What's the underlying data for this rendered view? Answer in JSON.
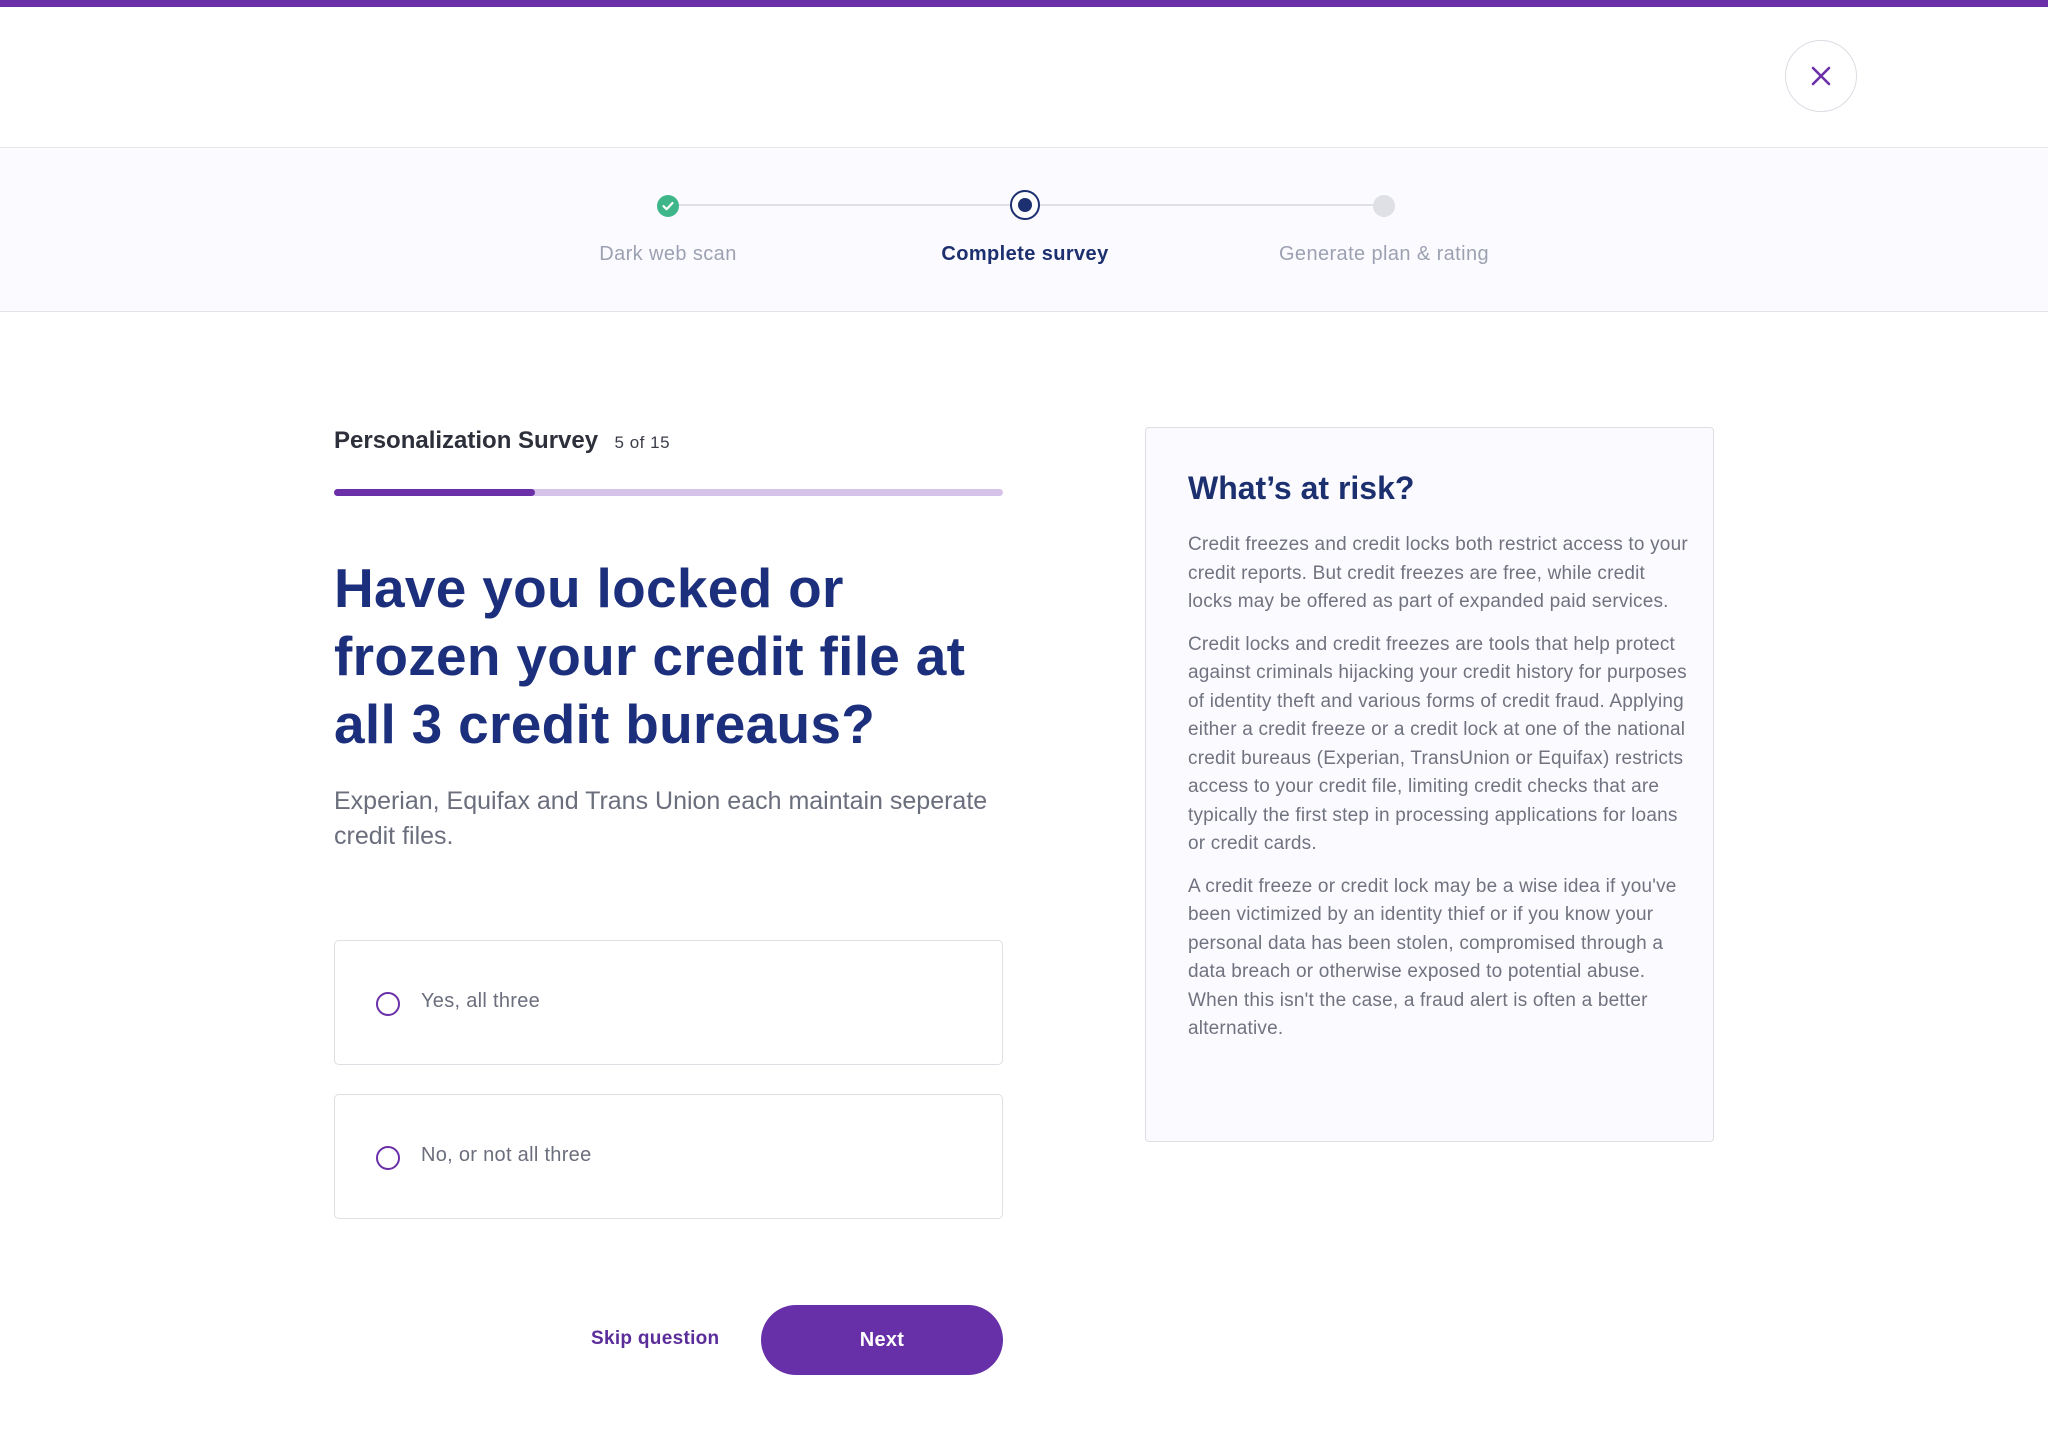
{
  "header": {
    "close_icon": "close-icon",
    "accent_color": "#6b2fa8"
  },
  "stepper": {
    "steps": [
      {
        "label": "Dark web scan",
        "state": "done",
        "icon": "check-circle-icon"
      },
      {
        "label": "Complete survey",
        "state": "active",
        "icon": "radio-dot-icon"
      },
      {
        "label": "Generate plan & rating",
        "state": "todo",
        "icon": "dot-icon"
      }
    ]
  },
  "survey": {
    "title": "Personalization Survey",
    "count": "5 of 15",
    "progress": 0.3
  },
  "question": {
    "text": "Have you locked or frozen your credit file at all 3 credit bureaus?",
    "subtext": "Experian, Equifax and Trans Union each maintain seperate credit files.",
    "options": [
      {
        "label": "Yes, all three",
        "selected": false
      },
      {
        "label": "No, or not all three",
        "selected": false
      }
    ]
  },
  "actions": {
    "skip_label": "Skip question",
    "next_label": "Next",
    "button_color": "#6730a8"
  },
  "risk": {
    "title": "What’s at risk?",
    "paragraphs": [
      "Credit freezes and credit locks both restrict access to your credit reports. But credit freezes are free, while credit locks may be offered as part of expanded paid services.",
      "Credit locks and credit freezes are tools that help protect against criminals hijacking your credit history for purposes of identity theft and various forms of credit fraud. Applying either a credit freeze or a credit lock at one of the national credit bureaus (Experian, TransUnion or Equifax) restricts access to your credit file, limiting credit checks that are typically the first step in processing applications for loans or credit cards.",
      "A credit freeze or credit lock may be a wise idea if you've been victimized by an identity thief or if you know your personal data has been stolen, compromised through a data breach or otherwise exposed to potential abuse. When this isn't the case, a fraud alert is often a better alternative."
    ]
  }
}
